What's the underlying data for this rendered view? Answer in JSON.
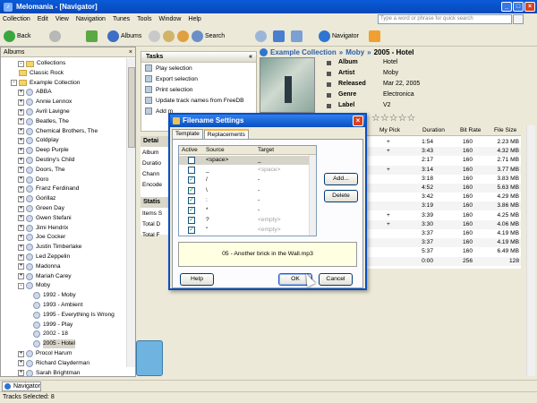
{
  "window": {
    "title": "Melomania - [Navigator]"
  },
  "menu": [
    "Collection",
    "Edit",
    "View",
    "Navigation",
    "Tunes",
    "Tools",
    "Window",
    "Help"
  ],
  "search": {
    "placeholder": "Type a word or phrase for quick search"
  },
  "toolbar": {
    "back": "Back",
    "albums": "Albums",
    "search": "Search",
    "navigator": "Navigator"
  },
  "left_pane": {
    "title": "Albums",
    "root": "Collections",
    "nodes": [
      "Classic Rock",
      "Example Collection",
      "ABBA",
      "Annie Lennox",
      "Avril Lavigne",
      "Beatles, The",
      "Chemical Brothers, The",
      "Coldplay",
      "Deep Purple",
      "Destiny's Child",
      "Doors, The",
      "Doro",
      "Franz Ferdinand",
      "Gorillaz",
      "Green Day",
      "Gwen Stefani",
      "Jimi Hendrix",
      "Joe Cocker",
      "Justin Timberlake",
      "Led Zeppelin",
      "Madonna",
      "Mariah Carey",
      "Moby",
      "1992 - Moby",
      "1993 - Ambient",
      "1995 - Everything Is Wrong",
      "1999 - Play",
      "2002 - 18",
      "2005 - Hotel",
      "Procol Harum",
      "Richard Clayderman",
      "Sarah Brightman",
      "Sarah Brooks"
    ]
  },
  "tasks": {
    "title": "Tasks",
    "items": [
      "Play selection",
      "Export selection",
      "Print selection",
      "Update track names from FreeDB",
      "Add m"
    ]
  },
  "details": {
    "title": "Detai",
    "labels": [
      "Album",
      "Duratio",
      "Chann",
      "Encode"
    ],
    "stats_title": "Statis",
    "stats": [
      "Items S",
      "Total D",
      "Total F"
    ]
  },
  "album": {
    "breadcrumb": [
      "Example Collection",
      "Moby",
      "2005 - Hotel"
    ],
    "fields": [
      {
        "k": "Album",
        "v": "Hotel"
      },
      {
        "k": "Artist",
        "v": "Moby"
      },
      {
        "k": "Released",
        "v": "Mar 22, 2005"
      },
      {
        "k": "Genre",
        "v": "Electronica"
      },
      {
        "k": "Label",
        "v": "V2"
      }
    ],
    "rating": "☆☆☆☆☆"
  },
  "tracks": {
    "headers": [
      "My Pick",
      "Duration",
      "Bit Rate",
      "File Size"
    ],
    "rows": [
      {
        "pick": "+",
        "dur": "1:54",
        "br": "160",
        "fs": "2.23 MB"
      },
      {
        "pick": "+",
        "dur": "3:43",
        "br": "160",
        "fs": "4.32 MB"
      },
      {
        "pick": "",
        "dur": "2:17",
        "br": "160",
        "fs": "2.71 MB"
      },
      {
        "pick": "+",
        "dur": "3:14",
        "br": "160",
        "fs": "3.77 MB"
      },
      {
        "pick": "",
        "dur": "3:18",
        "br": "160",
        "fs": "3.83 MB"
      },
      {
        "pick": "",
        "dur": "4:52",
        "br": "160",
        "fs": "5.63 MB"
      },
      {
        "pick": "",
        "dur": "3:42",
        "br": "160",
        "fs": "4.29 MB"
      },
      {
        "pick": "",
        "dur": "3:19",
        "br": "160",
        "fs": "3.86 MB"
      },
      {
        "pick": "+",
        "dur": "3:39",
        "br": "160",
        "fs": "4.25 MB"
      },
      {
        "pick": "+",
        "dur": "3:30",
        "br": "160",
        "fs": "4.06 MB"
      },
      {
        "pick": "",
        "dur": "3:37",
        "br": "160",
        "fs": "4.19 MB"
      },
      {
        "pick": "",
        "dur": "3:37",
        "br": "160",
        "fs": "4.19 MB"
      },
      {
        "pick": "",
        "dur": "5:37",
        "br": "160",
        "fs": "6.49 MB"
      },
      {
        "pick": "",
        "dur": "0:00",
        "br": "256",
        "fs": "128"
      }
    ]
  },
  "dialog": {
    "title": "Filename Settings",
    "tabs": [
      "Template",
      "Replacements"
    ],
    "columns": [
      "Active",
      "Source",
      "Target"
    ],
    "rows": [
      {
        "active": false,
        "source": "<space>",
        "target": "_"
      },
      {
        "active": false,
        "source": "_",
        "target": "<space>"
      },
      {
        "active": true,
        "source": "/",
        "target": "-"
      },
      {
        "active": true,
        "source": "\\",
        "target": "-"
      },
      {
        "active": true,
        "source": ":",
        "target": "-"
      },
      {
        "active": true,
        "source": "*",
        "target": "-"
      },
      {
        "active": true,
        "source": "?",
        "target": "<empty>"
      },
      {
        "active": true,
        "source": "\"",
        "target": "<empty>"
      }
    ],
    "add": "Add...",
    "delete": "Delete",
    "preview": "05 - Another brick in the Wall.mp3",
    "help": "Help",
    "ok": "OK",
    "cancel": "Cancel"
  },
  "bottom_tab": "Navigator",
  "status": "Tracks Selected: 8"
}
